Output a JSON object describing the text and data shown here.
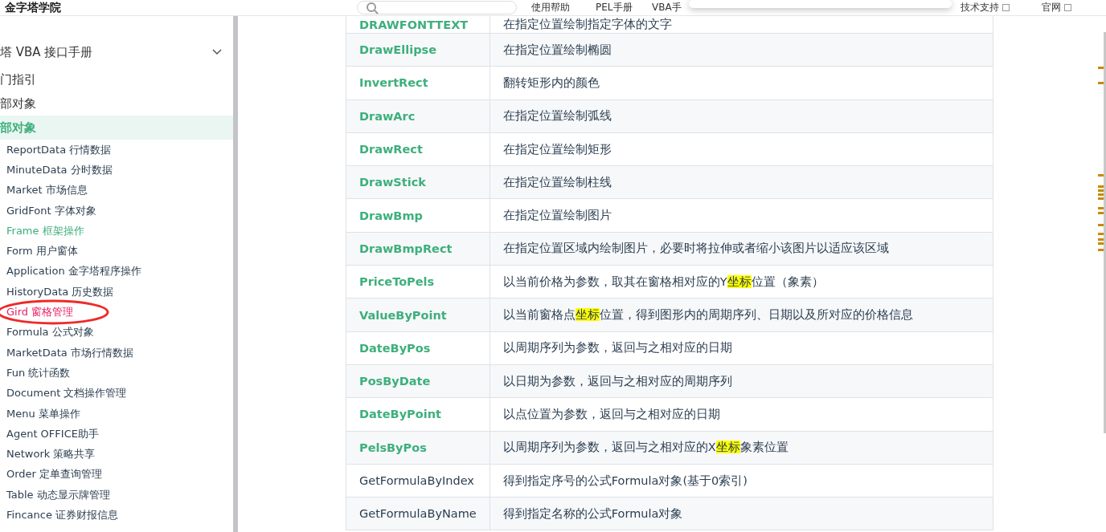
{
  "header": {
    "logo": "金字塔学院",
    "nav": [
      {
        "label": "使用帮助",
        "external": false
      },
      {
        "label": "PEL手册",
        "external": false
      },
      {
        "label": "VBA手",
        "external": false
      },
      {
        "label": "技术支持",
        "external": true
      },
      {
        "label": "官网",
        "external": true
      }
    ]
  },
  "sidebar": {
    "section": {
      "label": "塔 VBA 接口手册",
      "expanded": true
    },
    "groups": [
      {
        "label": "门指引",
        "selected": false
      },
      {
        "label": "部对象",
        "selected": false
      },
      {
        "label": "部对象",
        "selected": true
      }
    ],
    "items": [
      {
        "label": "ReportData 行情数据",
        "hovered": false,
        "selected": false
      },
      {
        "label": "MinuteData 分时数据",
        "hovered": false,
        "selected": false
      },
      {
        "label": "Market 市场信息",
        "hovered": false,
        "selected": false
      },
      {
        "label": "GridFont 字体对象",
        "hovered": false,
        "selected": false
      },
      {
        "label": "Frame 框架操作",
        "hovered": true,
        "selected": false
      },
      {
        "label": "Form 用户窗体",
        "hovered": false,
        "selected": false
      },
      {
        "label": "Application 金字塔程序操作",
        "hovered": false,
        "selected": false
      },
      {
        "label": "HistoryData 历史数据",
        "hovered": false,
        "selected": false
      },
      {
        "label": "Gird 窗格管理",
        "hovered": false,
        "selected": true
      },
      {
        "label": "Formula 公式对象",
        "hovered": false,
        "selected": false
      },
      {
        "label": "MarketData 市场行情数据",
        "hovered": false,
        "selected": false
      },
      {
        "label": "Fun 统计函数",
        "hovered": false,
        "selected": false
      },
      {
        "label": "Document 文档操作管理",
        "hovered": false,
        "selected": false
      },
      {
        "label": "Menu 菜单操作",
        "hovered": false,
        "selected": false
      },
      {
        "label": "Agent OFFICE助手",
        "hovered": false,
        "selected": false
      },
      {
        "label": "Network 策略共享",
        "hovered": false,
        "selected": false
      },
      {
        "label": "Order 定单查询管理",
        "hovered": false,
        "selected": false
      },
      {
        "label": "Table 动态显示牌管理",
        "hovered": false,
        "selected": false
      },
      {
        "label": "Fincance 证券财报信息",
        "hovered": false,
        "selected": false
      }
    ]
  },
  "table": {
    "rows": [
      {
        "name": "DRAWFONTTEXT",
        "kind": "link",
        "description": [
          {
            "text": "在指定位置绘制指定字体的文字",
            "highlight": false
          }
        ]
      },
      {
        "name": "DrawEllipse",
        "kind": "link",
        "description": [
          {
            "text": "在指定位置绘制椭圆",
            "highlight": false
          }
        ]
      },
      {
        "name": "InvertRect",
        "kind": "link",
        "description": [
          {
            "text": "翻转矩形内的颜色",
            "highlight": false
          }
        ]
      },
      {
        "name": "DrawArc",
        "kind": "link",
        "description": [
          {
            "text": "在指定位置绘制弧线",
            "highlight": false
          }
        ]
      },
      {
        "name": "DrawRect",
        "kind": "link",
        "description": [
          {
            "text": "在指定位置绘制矩形",
            "highlight": false
          }
        ]
      },
      {
        "name": "DrawStick",
        "kind": "link",
        "description": [
          {
            "text": "在指定位置绘制柱线",
            "highlight": false
          }
        ]
      },
      {
        "name": "DrawBmp",
        "kind": "link",
        "description": [
          {
            "text": "在指定位置绘制图片",
            "highlight": false
          }
        ]
      },
      {
        "name": "DrawBmpRect",
        "kind": "link",
        "description": [
          {
            "text": "在指定位置区域内绘制图片，必要时将拉伸或者缩小该图片以适应该区域",
            "highlight": false
          }
        ]
      },
      {
        "name": "PriceToPels",
        "kind": "link",
        "description": [
          {
            "text": "以当前价格为参数，取其在窗格相对应的Y",
            "highlight": false
          },
          {
            "text": "坐标",
            "highlight": true
          },
          {
            "text": "位置（象素）",
            "highlight": false
          }
        ]
      },
      {
        "name": "ValueByPoint",
        "kind": "link",
        "description": [
          {
            "text": "以当前窗格点",
            "highlight": false
          },
          {
            "text": "坐标",
            "highlight": true
          },
          {
            "text": "位置，得到图形内的周期序列、日期以及所对应的价格信息",
            "highlight": false
          }
        ]
      },
      {
        "name": "DateByPos",
        "kind": "link",
        "description": [
          {
            "text": "以周期序列为参数，返回与之相对应的日期",
            "highlight": false
          }
        ]
      },
      {
        "name": "PosByDate",
        "kind": "link",
        "description": [
          {
            "text": "以日期为参数，返回与之相对应的周期序列",
            "highlight": false
          }
        ]
      },
      {
        "name": "DateByPoint",
        "kind": "link",
        "description": [
          {
            "text": "以点位置为参数，返回与之相对应的日期",
            "highlight": false
          }
        ]
      },
      {
        "name": "PelsByPos",
        "kind": "link",
        "description": [
          {
            "text": "以周期序列为参数，返回与之相对应的X",
            "highlight": false
          },
          {
            "text": "坐标",
            "highlight": true
          },
          {
            "text": "象素位置",
            "highlight": false
          }
        ]
      },
      {
        "name": "GetFormulaByIndex",
        "kind": "plain",
        "description": [
          {
            "text": "得到指定序号的公式Formula对象(基于0索引)",
            "highlight": false
          }
        ]
      },
      {
        "name": "GetFormulaByName",
        "kind": "plain",
        "description": [
          {
            "text": "得到指定名称的公式Formula对象",
            "highlight": false
          }
        ]
      }
    ]
  }
}
